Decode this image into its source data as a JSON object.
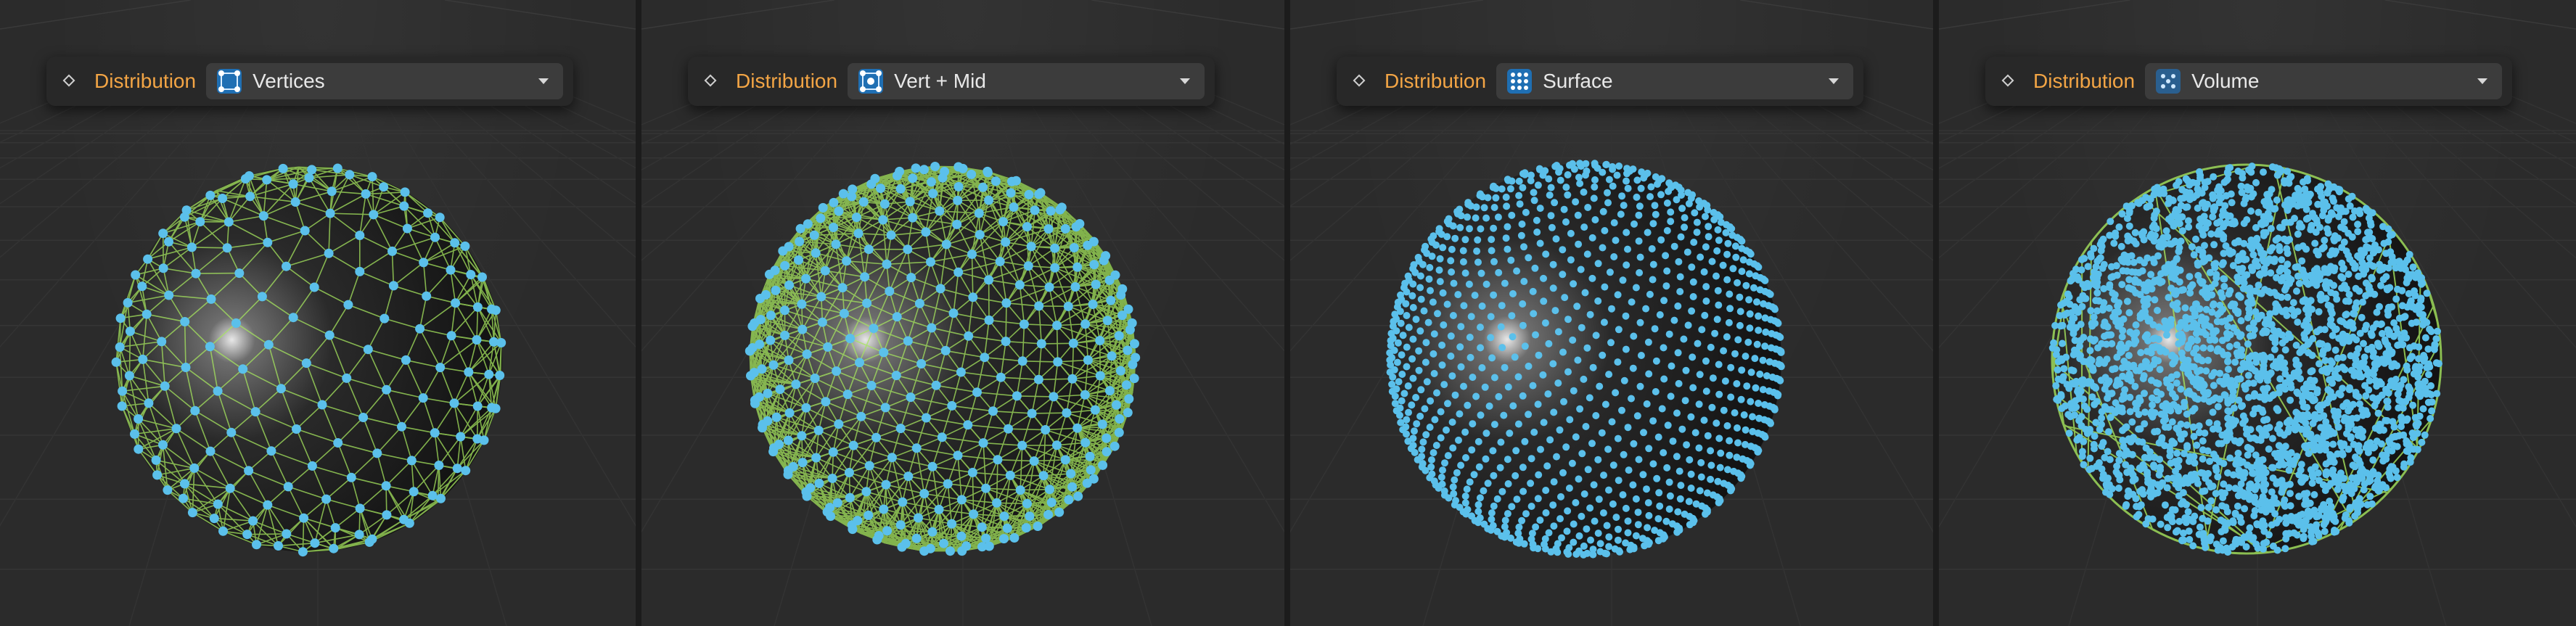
{
  "viewports": [
    {
      "label": "Distribution",
      "value": "Vertices",
      "icon": "vertices-icon"
    },
    {
      "label": "Distribution",
      "value": "Vert + Mid",
      "icon": "vert-mid-icon"
    },
    {
      "label": "Distribution",
      "value": "Surface",
      "icon": "surface-icon"
    },
    {
      "label": "Distribution",
      "value": "Volume",
      "icon": "volume-icon"
    }
  ],
  "colors": {
    "label": "#f3a545",
    "point": "#5bc0eb",
    "edge": "#a6e65e",
    "background": "#2b2b2b"
  }
}
